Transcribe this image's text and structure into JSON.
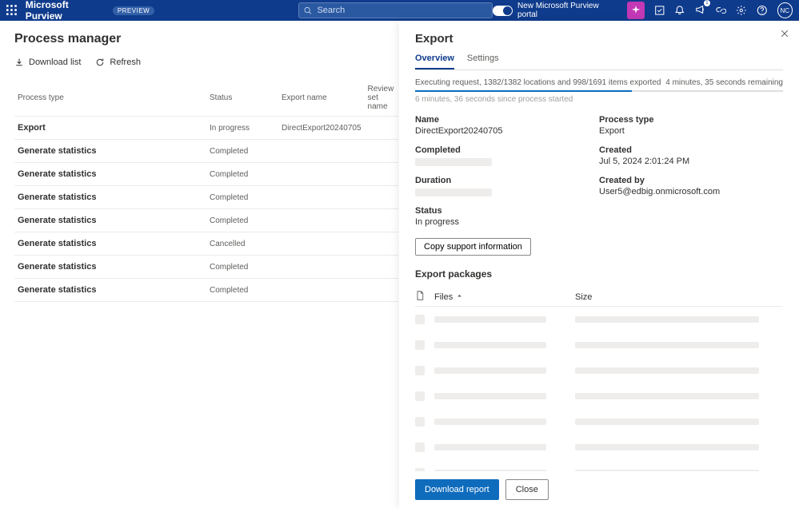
{
  "header": {
    "brand": "Microsoft Purview",
    "badge": "PREVIEW",
    "search_placeholder": "Search",
    "toggle_label": "New Microsoft Purview portal",
    "avatar_initials": "NC"
  },
  "page": {
    "title": "Process manager",
    "download_label": "Download list",
    "refresh_label": "Refresh"
  },
  "table": {
    "cols": {
      "c1": "Process type",
      "c2": "Status",
      "c3": "Export name",
      "c4": "Review set name"
    },
    "rows": [
      {
        "type": "Export",
        "status": "In progress",
        "export_name": "DirectExport20240705"
      },
      {
        "type": "Generate statistics",
        "status": "Completed",
        "export_name": ""
      },
      {
        "type": "Generate statistics",
        "status": "Completed",
        "export_name": ""
      },
      {
        "type": "Generate statistics",
        "status": "Completed",
        "export_name": ""
      },
      {
        "type": "Generate statistics",
        "status": "Completed",
        "export_name": ""
      },
      {
        "type": "Generate statistics",
        "status": "Cancelled",
        "export_name": ""
      },
      {
        "type": "Generate statistics",
        "status": "Completed",
        "export_name": ""
      },
      {
        "type": "Generate statistics",
        "status": "Completed",
        "export_name": ""
      }
    ]
  },
  "panel": {
    "title": "Export",
    "tabs": {
      "overview": "Overview",
      "settings": "Settings"
    },
    "progress_text": "Executing request, 1382/1382 locations and 998/1691 items exported",
    "remaining": "4 minutes, 35 seconds remaining",
    "elapsed": "6 minutes, 36 seconds since process started",
    "fields": {
      "name_label": "Name",
      "name_value": "DirectExport20240705",
      "process_type_label": "Process type",
      "process_type_value": "Export",
      "completed_label": "Completed",
      "created_label": "Created",
      "created_value": "Jul 5, 2024 2:01:24 PM",
      "duration_label": "Duration",
      "created_by_label": "Created by",
      "created_by_value": "User5@edbig.onmicrosoft.com",
      "status_label": "Status",
      "status_value": "In progress"
    },
    "copy_btn": "Copy support information",
    "packages_title": "Export packages",
    "files_col": "Files",
    "size_col": "Size",
    "download_btn": "Download report",
    "close_btn": "Close"
  }
}
